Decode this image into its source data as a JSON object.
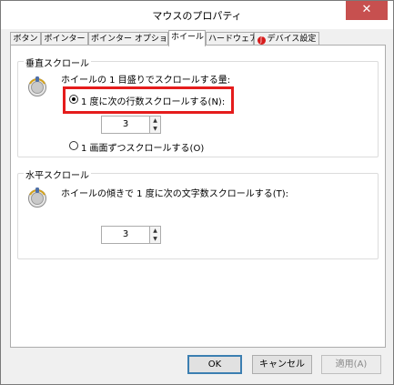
{
  "window": {
    "title": "マウスのプロパティ",
    "close_glyph": "✕"
  },
  "tabs": [
    {
      "label": "ボタン"
    },
    {
      "label": "ポインター"
    },
    {
      "label": "ポインター オプション"
    },
    {
      "label": "ホイール",
      "active": true
    },
    {
      "label": "ハードウェア"
    },
    {
      "label": "デバイス設定",
      "icon": "synaptics-icon"
    }
  ],
  "vertical_scroll": {
    "group_label": "垂直スクロール",
    "amount_label": "ホイールの 1 目盛りでスクロールする量:",
    "option_lines_label": "1 度に次の行数スクロールする(N):",
    "lines_value": "3",
    "option_screen_label": "1 画面ずつスクロールする(O)",
    "selected_option": "lines",
    "icon": "mouse-wheel-icon"
  },
  "horizontal_scroll": {
    "group_label": "水平スクロール",
    "tilt_label": "ホイールの傾きで 1 度に次の文字数スクロールする(T):",
    "chars_value": "3",
    "icon": "mouse-wheel-icon"
  },
  "buttons": {
    "ok_label": "OK",
    "cancel_label": "キャンセル",
    "apply_label": "適用(A)"
  },
  "colors": {
    "highlight": "#e51c1c",
    "close_button": "#c7504f"
  }
}
